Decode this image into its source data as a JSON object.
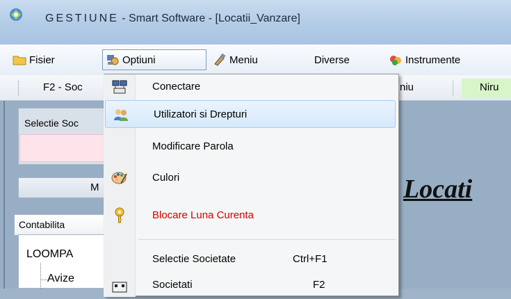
{
  "window": {
    "title_spaced": "GESTIUNE",
    "title_rest": " - Smart Software  - [Locatii_Vanzare]"
  },
  "menubar": {
    "items": [
      {
        "label": "Fisier",
        "icon": "folder-icon"
      },
      {
        "label": "Optiuni",
        "icon": "options-icon"
      },
      {
        "label": "Meniu",
        "icon": "brush-icon"
      },
      {
        "label": "Diverse",
        "icon": ""
      },
      {
        "label": "Instrumente",
        "icon": "tools-icon"
      }
    ]
  },
  "toolbar": {
    "items": [
      "F2 - Soc",
      "niu",
      "Niru"
    ]
  },
  "main": {
    "selectie_label": "Selectie Soc",
    "m_button": "M",
    "big_title": "Locati",
    "tab_label": "Contabilita",
    "tree_root": "LOOMPA",
    "tree_child": "Avize"
  },
  "dropdown": {
    "items": [
      {
        "label": "Conectare",
        "icon": "computer-connect-icon"
      },
      {
        "label": "Utilizatori si  Drepturi",
        "icon": "users-icon",
        "highlighted": true
      },
      {
        "label": "Modificare Parola",
        "icon": ""
      },
      {
        "label": "Culori",
        "icon": "palette-icon"
      },
      {
        "label": "Blocare Luna Curenta",
        "icon": "key-icon",
        "color": "#d40000"
      },
      {
        "label": "Selectie Societate",
        "shortcut": "Ctrl+F1",
        "icon": ""
      },
      {
        "label": "Societati",
        "shortcut": "F2",
        "icon": "companies-icon"
      }
    ]
  },
  "colors": {
    "menu_highlight": "#d6e9fb",
    "red_text": "#d40000",
    "toolbar_green": "#d8f5c8"
  }
}
